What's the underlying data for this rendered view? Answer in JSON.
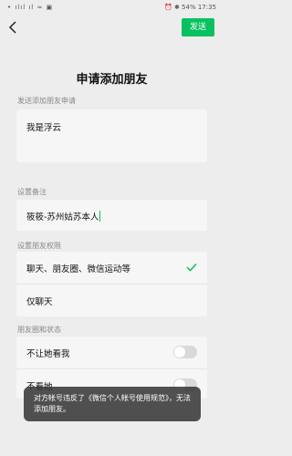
{
  "status_bar": {
    "left": "• ılıl ıl ≈ ▣",
    "right": "⏰ ✱ 54% 17:35"
  },
  "header": {
    "send_label": "发送"
  },
  "title": "申请添加朋友",
  "request": {
    "label": "发送添加朋友申请",
    "value": "我是浮云"
  },
  "remark": {
    "label": "设置备注",
    "value": "筱筱-苏州姑苏本人"
  },
  "permissions": {
    "label": "设置朋友权限",
    "options": [
      {
        "label": "聊天、朋友圈、微信运动等",
        "selected": true
      },
      {
        "label": "仅聊天",
        "selected": false
      }
    ]
  },
  "moments": {
    "label": "朋友圈和状态",
    "items": [
      {
        "label": "不让她看我",
        "on": false
      },
      {
        "label": "不看她",
        "on": false
      }
    ]
  },
  "toast": {
    "text": "对方帐号违反了《微信个人帐号使用规范》，无法添加朋友。"
  },
  "colors": {
    "accent": "#07c160",
    "background": "#ededed",
    "field": "#f6f6f6"
  }
}
